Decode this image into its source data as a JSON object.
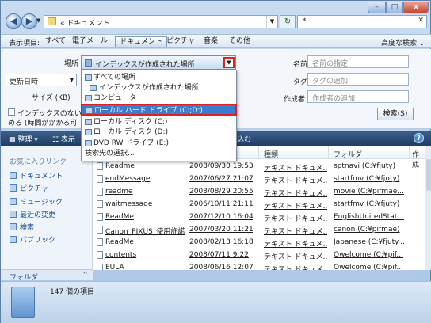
{
  "address": {
    "crumb": "« ドキュメント",
    "search_value": "*"
  },
  "window_controls": {
    "min": "–",
    "max": "□",
    "close": "x"
  },
  "filterbar": {
    "label": "表示項目:",
    "tabs": [
      "すべて",
      "電子メール",
      "ドキュメント",
      "ピクチャ",
      "音楽",
      "その他"
    ],
    "active": "ドキュメント",
    "advanced": "高度な検索"
  },
  "searchpane": {
    "location_label": "場所",
    "location_value": "インデックスが作成された場所",
    "date_combo": "更新日時",
    "size_label": "サイズ (KB)",
    "index_check_line1": "インデックスのないフ",
    "index_check_line2": "める (時間がかかる可",
    "name_label": "名前",
    "name_placeholder": "名前の指定",
    "tag_label": "タグ",
    "tag_placeholder": "タグの追加",
    "author_label": "作成者",
    "author_placeholder": "作成者の追加",
    "search_button": "検索(S)"
  },
  "toolbar": {
    "organize": "整理",
    "view": "表示",
    "save_search": "込む",
    "help": "?"
  },
  "menu": {
    "items": [
      {
        "label": "すべての場所",
        "nested": false
      },
      {
        "label": "インデックスが作成された場所",
        "nested": true
      },
      {
        "label": "コンピュータ",
        "nested": false
      },
      {
        "label": "ローカル ハード ドライブ (C:;D:)",
        "nested": false,
        "selected": true
      },
      {
        "label": "ローカル ディスク (C:)",
        "nested": false
      },
      {
        "label": "ローカル ディスク (D:)",
        "nested": false
      },
      {
        "label": "DVD RW ドライブ (E:)",
        "nested": false
      },
      {
        "label": "検索先の選択...",
        "nested": false
      }
    ]
  },
  "leftnav": {
    "heading": "お気に入りリンク",
    "items": [
      "ドキュメント",
      "ピクチャ",
      "ミュージック",
      "最近の変更",
      "検索",
      "パブリック"
    ],
    "folder_bar": "フォルダ",
    "folder_chevron": "^"
  },
  "list": {
    "headers": [
      "種類",
      "フォルダ",
      "作成"
    ],
    "rows": [
      {
        "name": "Readme",
        "date": "2008/09/30 19:53",
        "type": "テキスト ドキュメ...",
        "folder": "sptnavi (C:¥fjuty)"
      },
      {
        "name": "endMessage",
        "date": "2007/06/27 21:07",
        "type": "テキスト ドキュメ...",
        "folder": "startfmv (C:¥fjuty)"
      },
      {
        "name": "readme",
        "date": "2008/08/29 20:55",
        "type": "テキスト ドキュメ...",
        "folder": "movie (C:¥pifmae..."
      },
      {
        "name": "waitmessage",
        "date": "2006/10/11 21:11",
        "type": "テキスト ドキュメ...",
        "folder": "startfmv (C:¥fjuty)"
      },
      {
        "name": "ReadMe",
        "date": "2007/12/10 16:04",
        "type": "テキスト ドキュメ...",
        "folder": "EnglishUnitedStat..."
      },
      {
        "name": "Canon_PIXUS_使用許諾",
        "date": "2007/03/20 11:21",
        "type": "テキスト ドキュメ...",
        "folder": "canon (C:¥pifmae)"
      },
      {
        "name": "ReadMe",
        "date": "2008/02/13 16:18",
        "type": "テキスト ドキュメ...",
        "folder": "Japanese (C:¥fjuty..."
      },
      {
        "name": "contents",
        "date": "2008/07/11 9:22",
        "type": "テキスト ドキュメ...",
        "folder": "Owelcome (C:¥pif..."
      },
      {
        "name": "EULA",
        "date": "2008/06/16 12:07",
        "type": "テキスト ドキュメ...",
        "folder": "Owelcome (C:¥pif..."
      }
    ]
  },
  "status": {
    "count": "147 個の項目"
  }
}
